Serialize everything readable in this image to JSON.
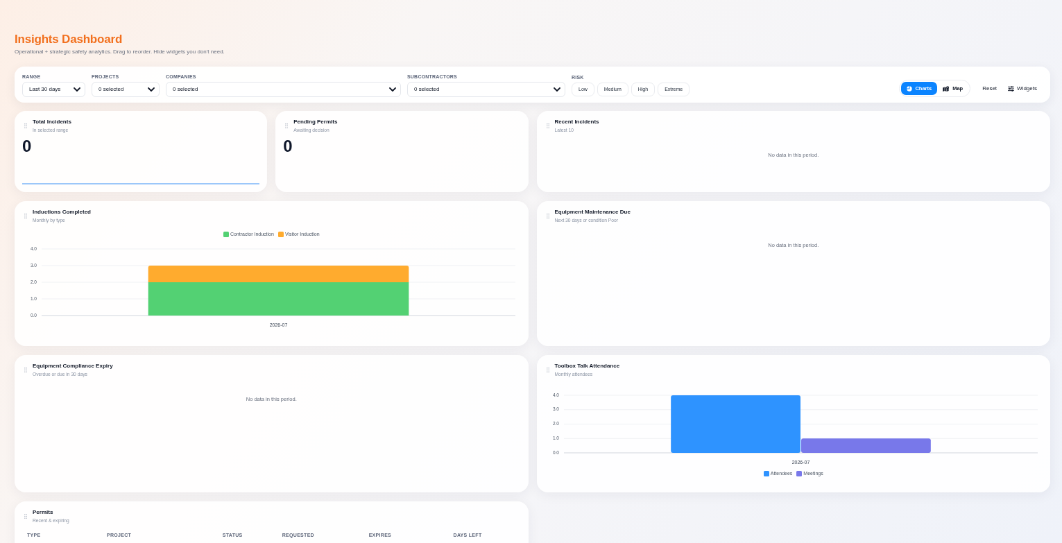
{
  "header": {
    "title": "Insights Dashboard",
    "subtitle": "Operational + strategic safety analytics. Drag to reorder. Hide widgets you don't need."
  },
  "filters": {
    "selects": [
      {
        "label": "RANGE",
        "value": "Last 30 days"
      },
      {
        "label": "PROJECTS",
        "value": "0 selected"
      },
      {
        "label": "COMPANIES",
        "value": "0 selected"
      },
      {
        "label": "SUBCONTRACTORS",
        "value": "0 selected"
      }
    ],
    "risk": {
      "label": "RISK",
      "options": [
        {
          "label": "Low",
          "selected": false
        },
        {
          "label": "Medium",
          "selected": false
        },
        {
          "label": "High",
          "selected": false
        },
        {
          "label": "Extreme",
          "selected": false
        }
      ]
    },
    "view_toggle": [
      {
        "label": "Charts",
        "selected": true
      },
      {
        "label": "Map",
        "selected": false
      }
    ],
    "actions": [
      {
        "label": "Reset",
        "kind": "text"
      },
      {
        "label": "Widgets",
        "kind": "icon_text"
      }
    ]
  },
  "widgets": [
    {
      "kind": "stat",
      "title": "Total Incidents",
      "subtitle": "In selected range",
      "value": "0",
      "trend_line": true
    },
    {
      "kind": "stat",
      "title": "Pending Permits",
      "subtitle": "Awaiting decision",
      "value": "0",
      "trend_line": false
    },
    {
      "kind": "message",
      "title": "Recent Incidents",
      "subtitle": "Latest 10",
      "message": "No data in this period."
    },
    {
      "kind": "chart",
      "title": "Inductions Completed",
      "subtitle": "Monthly by type",
      "chart_data": {
        "type": "bar",
        "categories": [
          "2026-07"
        ],
        "series": [
          {
            "name": "Contractor Induction",
            "color": "#53d173",
            "values": [
              2
            ]
          },
          {
            "name": "Visitor Induction",
            "color": "#ffab2e",
            "values": [
              1
            ]
          }
        ],
        "stacked": true,
        "grid": true,
        "ylim": [
          0,
          4
        ],
        "yticks": [
          {
            "value": 0,
            "label": "0.0"
          },
          {
            "value": 1,
            "label": "1.0"
          },
          {
            "value": 2,
            "label": "2.0"
          },
          {
            "value": 3,
            "label": "3.0"
          },
          {
            "value": 4,
            "label": "4.0"
          }
        ]
      }
    },
    {
      "kind": "message",
      "title": "Equipment Maintenance Due",
      "subtitle": "Next 30 days or condition Poor",
      "message": "No data in this period."
    },
    {
      "kind": "message",
      "title": "Equipment Compliance Expiry",
      "subtitle": "Overdue or due in 30 days",
      "message": "No data in this period."
    },
    {
      "kind": "chart",
      "title": "Toolbox Talk Attendance",
      "subtitle": "Monthly attendees",
      "chart_data": {
        "type": "bar",
        "categories": [
          "2026-07"
        ],
        "series": [
          {
            "name": "Attendees",
            "color": "#2e93ff",
            "values": [
              4
            ]
          },
          {
            "name": "Meetings",
            "color": "#7878ea",
            "values": [
              1
            ]
          }
        ],
        "stacked": false,
        "grid": true,
        "ylim": [
          0,
          4
        ],
        "yticks": [
          {
            "value": 0,
            "label": "0.0"
          },
          {
            "value": 1,
            "label": "1.0"
          },
          {
            "value": 2,
            "label": "2.0"
          },
          {
            "value": 3,
            "label": "3.0"
          },
          {
            "value": 4,
            "label": "4.0"
          }
        ]
      }
    },
    {
      "kind": "table",
      "title": "Permits",
      "subtitle": "Recent & expiring",
      "columns": [
        "TYPE",
        "PROJECT",
        "STATUS",
        "REQUESTED",
        "EXPIRES",
        "DAYS LEFT"
      ]
    }
  ]
}
